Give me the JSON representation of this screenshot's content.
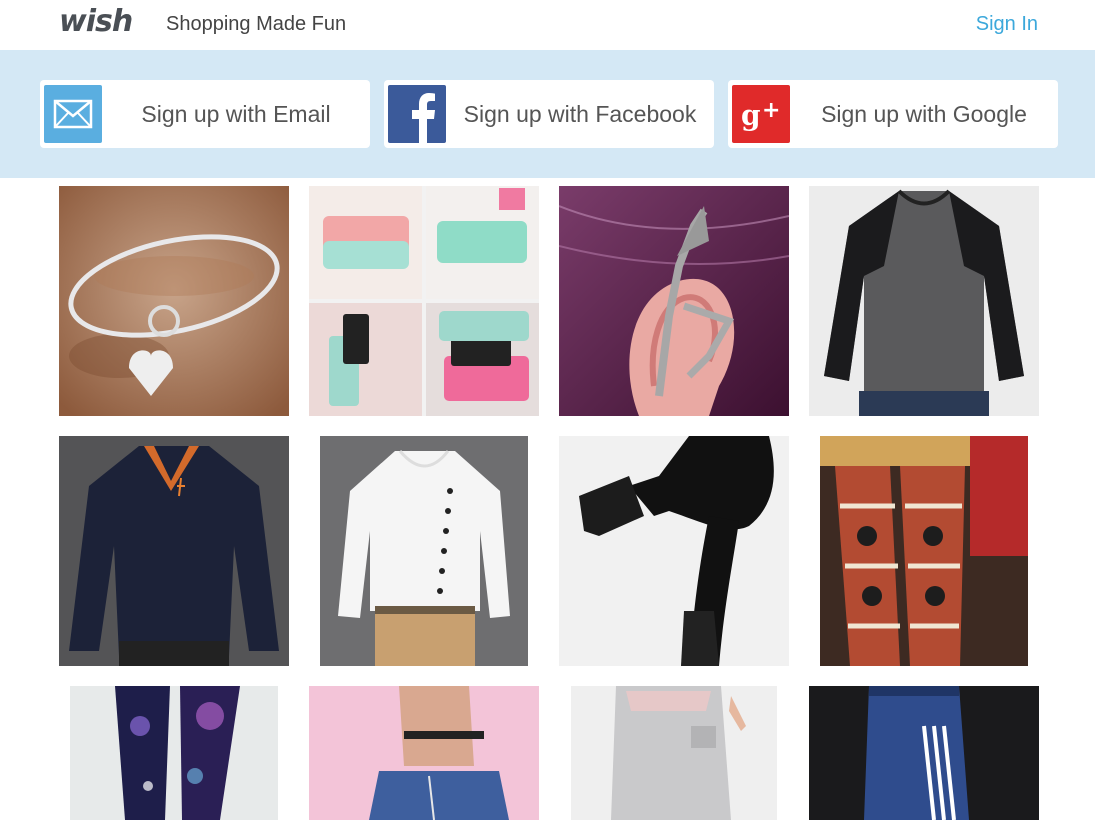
{
  "header": {
    "logo": "wish",
    "tagline": "Shopping Made Fun",
    "signin_label": "Sign In"
  },
  "signup": {
    "email_label": "Sign up with Email",
    "facebook_label": "Sign up with Facebook",
    "google_label": "Sign up with Google"
  },
  "colors": {
    "signin": "#3ca8db",
    "signup_bar": "#d4e8f5",
    "email": "#5aaee0",
    "facebook": "#3b5a9a",
    "google": "#e02a2a"
  },
  "products": [
    {
      "name": "heart-lock-bangle"
    },
    {
      "name": "pastel-phone-wallets"
    },
    {
      "name": "dragon-ear-cuff"
    },
    {
      "name": "gray-raglan-shirt"
    },
    {
      "name": "navy-polo-shirt"
    },
    {
      "name": "white-henley-shirt"
    },
    {
      "name": "black-leggings-boots"
    },
    {
      "name": "nordic-print-leggings"
    },
    {
      "name": "galaxy-print-leggings"
    },
    {
      "name": "denim-print-shorts"
    },
    {
      "name": "gray-harem-pants"
    },
    {
      "name": "blue-track-pants"
    }
  ]
}
